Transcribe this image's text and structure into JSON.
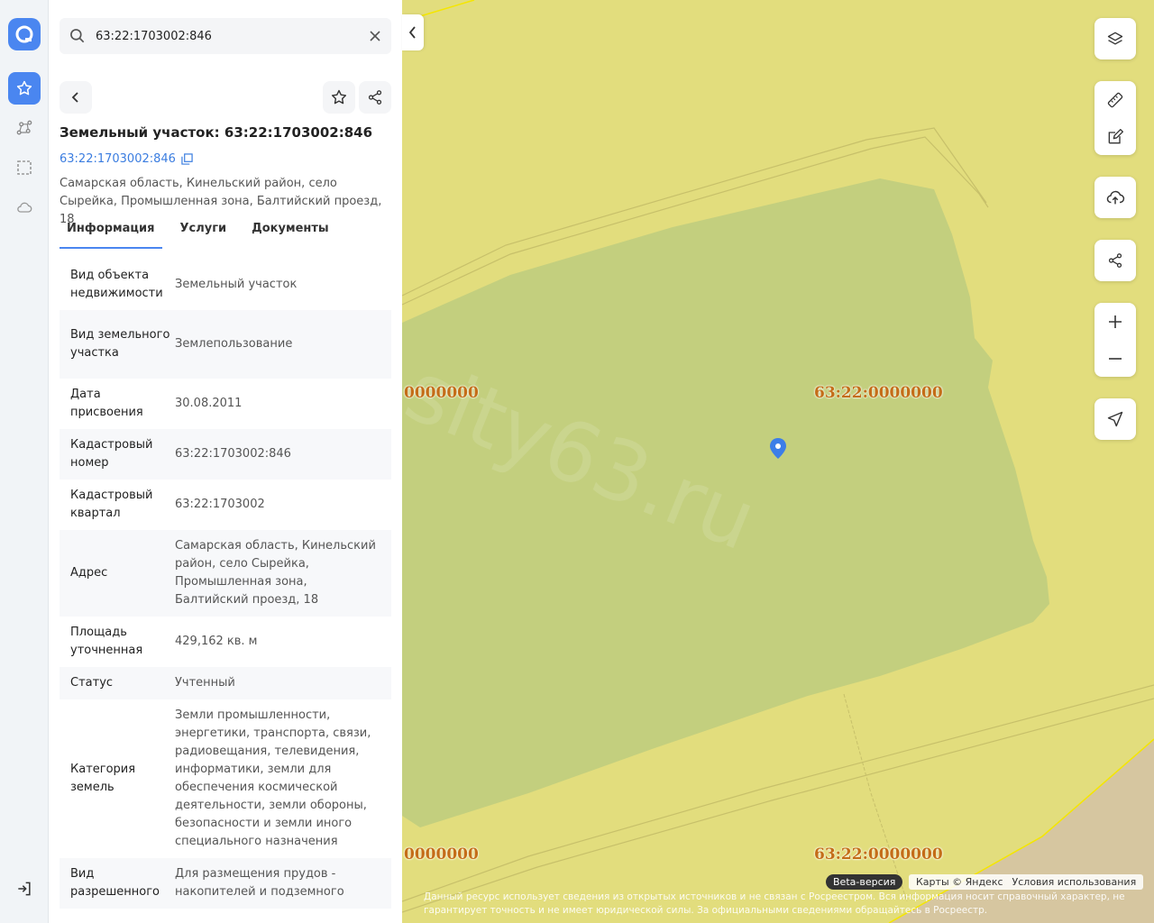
{
  "search": {
    "value": "63:22:1703002:846"
  },
  "object": {
    "title": "Земельный участок: 63:22:1703002:846",
    "cad_number_link": "63:22:1703002:846",
    "address": "Самарская область, Кинельский район, село Сырейка, Промышленная зона, Балтийский проезд, 18"
  },
  "tabs": [
    {
      "label": "Информация"
    },
    {
      "label": "Услуги"
    },
    {
      "label": "Документы"
    }
  ],
  "info": [
    {
      "key": "Вид объекта недвижимости",
      "value": "Земельный участок"
    },
    {
      "key": "Вид земельного участка",
      "value": "Землепользование"
    },
    {
      "key": "Дата присвоения",
      "value": "30.08.2011"
    },
    {
      "key": "Кадастровый номер",
      "value": "63:22:1703002:846"
    },
    {
      "key": "Кадастровый квартал",
      "value": "63:22:1703002"
    },
    {
      "key": "Адрес",
      "value": "Самарская область, Кинельский район, село Сырейка, Промышленная зона, Балтийский проезд, 18"
    },
    {
      "key": "Площадь уточненная",
      "value": "429,162 кв. м"
    },
    {
      "key": "Статус",
      "value": "Учтенный"
    },
    {
      "key": "Категория земель",
      "value": "Земли промышленности, энергетики, транспорта, связи, радиовещания, телевидения, информатики, земли для обеспечения космической деятельности, земли обороны, безопасности и земли иного специального назначения"
    },
    {
      "key": "Вид разрешенного",
      "value": "Для размещения прудов - накопителей и подземного"
    }
  ],
  "map": {
    "watermark": "sity63.ru",
    "quarter_labels": [
      "0000000",
      "63:22:0000000",
      "0000000",
      "63:22:0000000"
    ],
    "beta_label": "Beta-версия",
    "attribution": "Карты © Яндекс",
    "terms_link": "Условия использования",
    "disclaimer": "Данный ресурс использует сведения из открытых источников и не связан с Росреестром. Вся информация носит справочный характер, не гарантирует точность и не имеет юридической силы. За официальными сведениями обращайтесь в Росреестр."
  },
  "colors": {
    "accent": "#4a86f0",
    "map_bg": "#e2dd7d",
    "parcel": "#c3cf7e",
    "label": "#c46d18"
  }
}
